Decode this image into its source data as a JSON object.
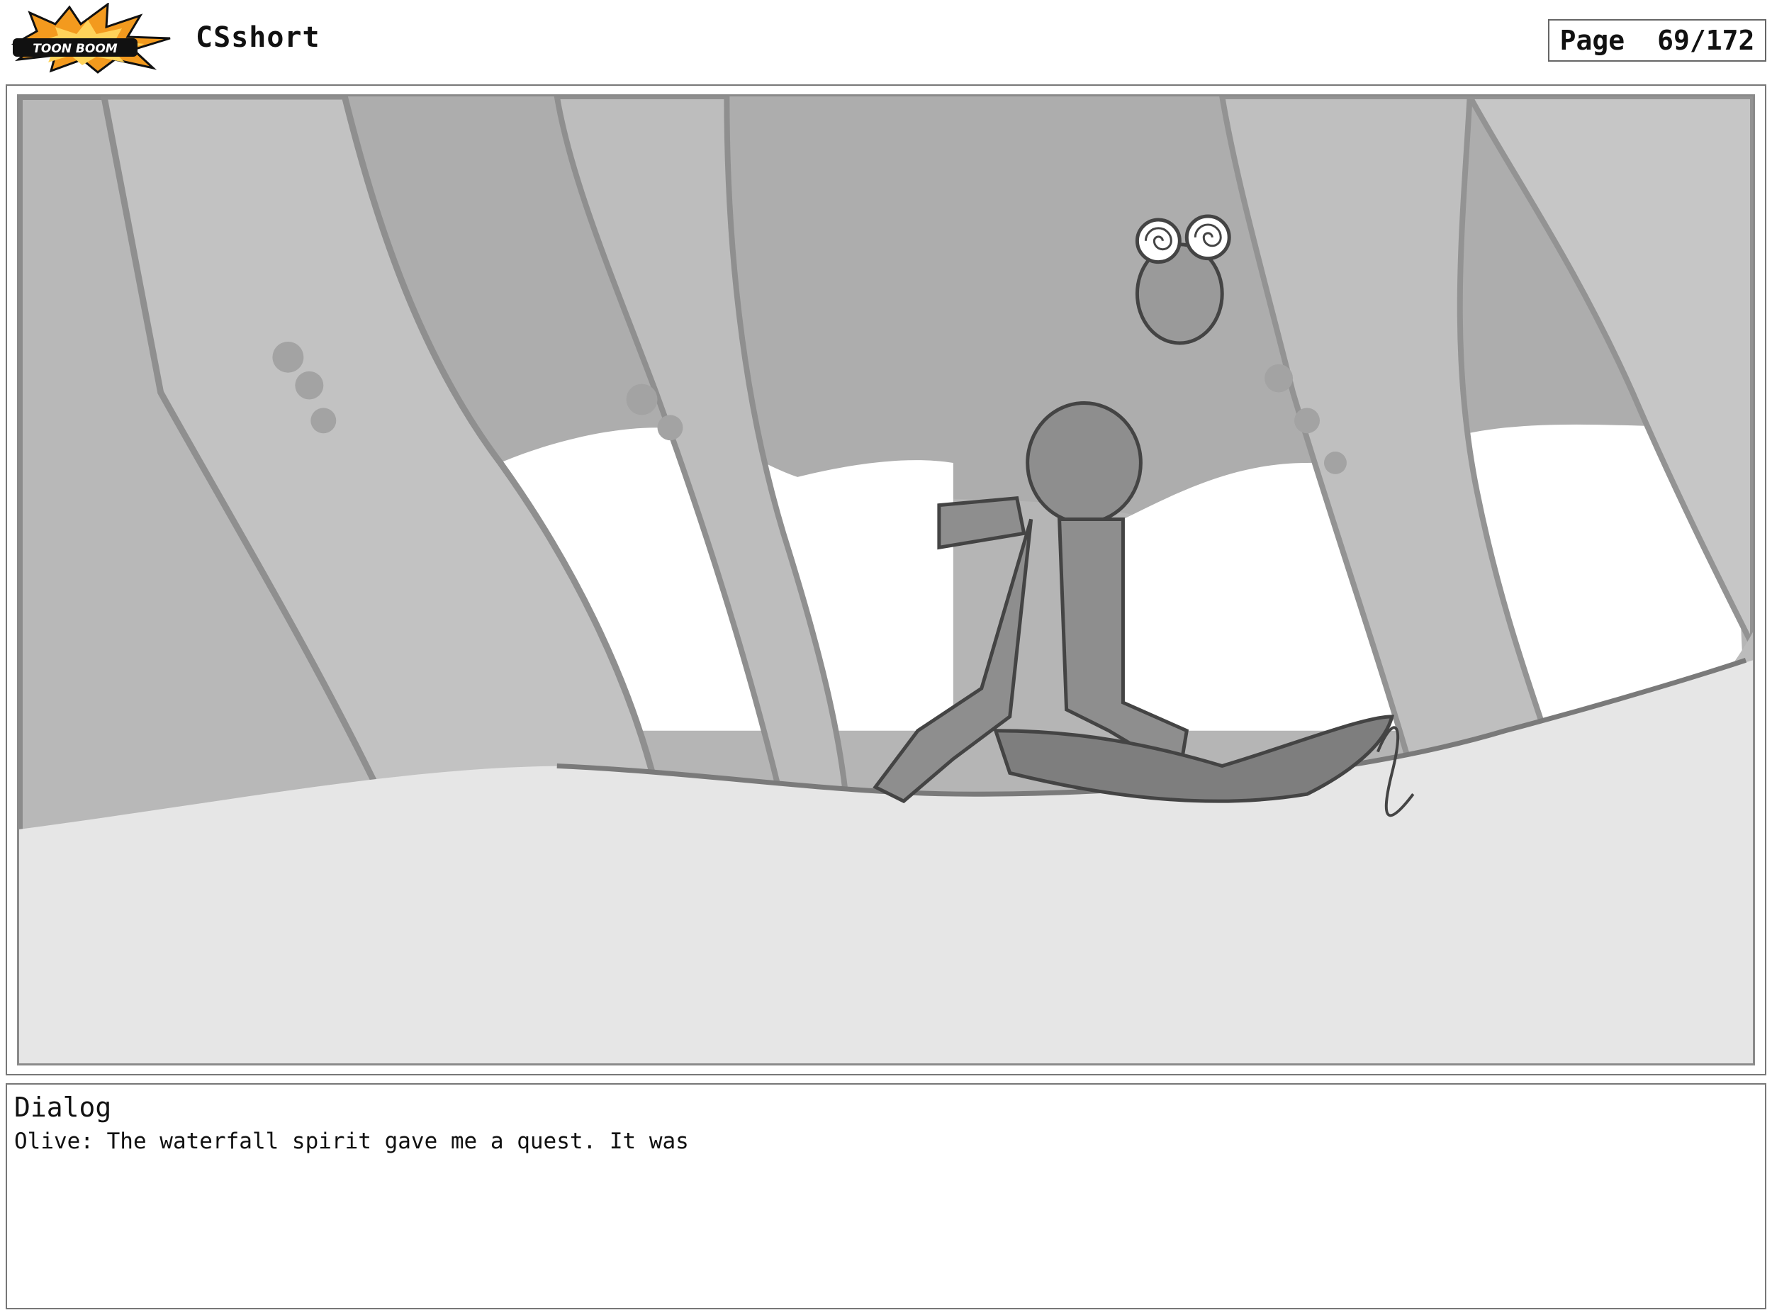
{
  "header": {
    "logo_text": "TOON BOOM",
    "title": "CSshort",
    "page_label": "Page",
    "page_number": "69/172"
  },
  "panel": {
    "image_description_icon": "storyboard-sketch"
  },
  "dialog": {
    "heading": "Dialog",
    "text": "Olive: The waterfall spirit gave me a quest. It was"
  },
  "colors": {
    "logo_orange": "#f39a1e",
    "logo_black": "#111111",
    "sketch_dark": "#7a7a7a",
    "sketch_mid": "#a8a8a8",
    "sketch_light": "#e6e6e6"
  }
}
